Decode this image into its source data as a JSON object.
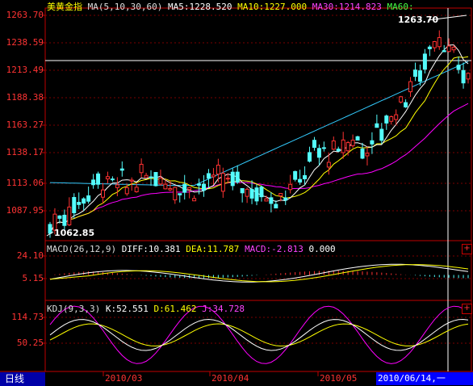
{
  "header": {
    "symbol": "美黄金指",
    "ma_label": "MA(5,10,30,60)",
    "ma5": "MA5:1228.520",
    "ma10": "MA10:1227.000",
    "ma30": "MA30:1214.823",
    "ma60": "MA60:"
  },
  "macd_header": {
    "label": "MACD(26,12,9)",
    "diff": "DIFF:10.381",
    "dea": "DEA:11.787",
    "macd": "MACD:-2.813",
    "extra": "0.000"
  },
  "kdj_header": {
    "label": "KDJ(9,3,3)",
    "k": "K:52.551",
    "d": "D:61.462",
    "j": "J:34.728"
  },
  "price_axis": [
    "1263.70",
    "1238.59",
    "1213.49",
    "1188.38",
    "1163.27",
    "1138.17",
    "1113.06",
    "1087.95"
  ],
  "macd_axis": [
    "24.10",
    "5.15"
  ],
  "kdj_axis": [
    "114.73",
    "50.25"
  ],
  "annotations": {
    "high": "1263.70",
    "low": "1062.85"
  },
  "footer": {
    "period": "日线",
    "dates": [
      "2010/03",
      "2010/04",
      "2010/05"
    ],
    "cursor_date": "2010/06/14,一"
  },
  "buttons": {
    "expand": "+"
  },
  "colors": {
    "up": "#ff3232",
    "down": "#54fcfc",
    "ma5": "#ffffff",
    "ma10": "#ffff00",
    "ma30": "#ff00ff",
    "ma60": "#00ff00",
    "axis": "#c00000",
    "label": "#ff3333"
  },
  "chart_data": {
    "type": "candlestick",
    "price_range": [
      1062.85,
      1263.7
    ],
    "highest": 1263.7,
    "lowest": 1062.85,
    "ma_last": {
      "ma5": 1228.52,
      "ma10": 1227.0,
      "ma30": 1214.823
    },
    "macd_last": {
      "diff": 10.381,
      "dea": 11.787,
      "macd": -2.813
    },
    "kdj_last": {
      "k": 52.551,
      "d": 61.462,
      "j": 34.728
    }
  }
}
